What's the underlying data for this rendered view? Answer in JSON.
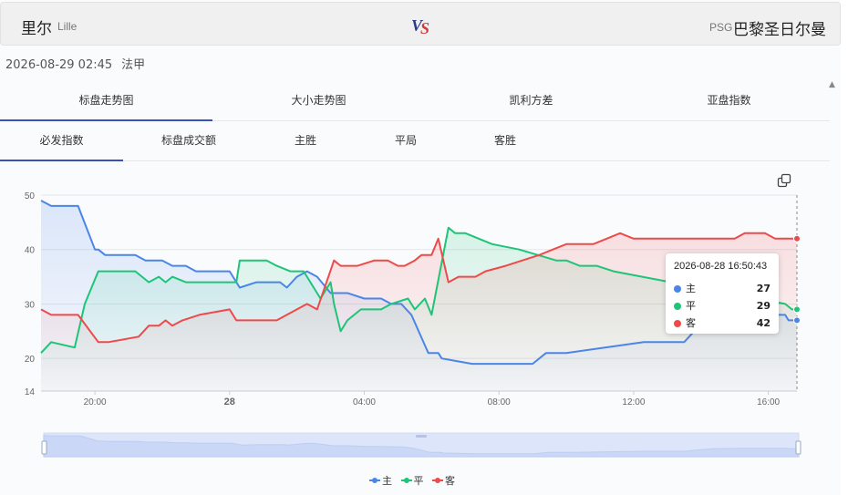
{
  "match": {
    "home_name": "里尔",
    "home_en": "Lille",
    "vs_v": "V",
    "vs_s": "S",
    "away_abbr": "PSG",
    "away_name": "巴黎圣日尔曼",
    "datetime": "2026-08-29 02:45",
    "league": "法甲"
  },
  "tabs_primary": [
    {
      "label": "标盘走势图",
      "active": true
    },
    {
      "label": "大小走势图",
      "active": false
    },
    {
      "label": "凯利方差",
      "active": false
    },
    {
      "label": "亚盘指数",
      "active": false
    }
  ],
  "tabs_secondary": [
    {
      "label": "必发指数",
      "active": true
    },
    {
      "label": "标盘成交额",
      "active": false
    },
    {
      "label": "主胜",
      "active": false
    },
    {
      "label": "平局",
      "active": false
    },
    {
      "label": "客胜",
      "active": false
    }
  ],
  "tooltip": {
    "time": "2026-08-28 16:50:43",
    "rows": [
      {
        "name": "主",
        "value": "27"
      },
      {
        "name": "平",
        "value": "29"
      },
      {
        "name": "客",
        "value": "42"
      }
    ]
  },
  "colors": {
    "home": "#4a86e8",
    "draw": "#1ec477",
    "away": "#ee4a4a",
    "tab_accent": "#3a51b8"
  },
  "chart_data": {
    "type": "area",
    "x_unit": "hours from 2026-08-27 18:00",
    "x_ticks": [
      {
        "x": 2,
        "label": "20:00",
        "bold": false
      },
      {
        "x": 6,
        "label": "28",
        "bold": true
      },
      {
        "x": 10,
        "label": "04:00",
        "bold": false
      },
      {
        "x": 14,
        "label": "08:00",
        "bold": false
      },
      {
        "x": 18,
        "label": "12:00",
        "bold": false
      },
      {
        "x": 22,
        "label": "16:00",
        "bold": false
      }
    ],
    "xlim": [
      0.4,
      22.85
    ],
    "ylim": [
      14,
      50
    ],
    "y_ticks": [
      14,
      20,
      30,
      40,
      50
    ],
    "legend": "bottom",
    "grid": true,
    "series": [
      {
        "name": "主",
        "color": "#4a86e8",
        "points": [
          [
            0.4,
            49
          ],
          [
            0.7,
            48
          ],
          [
            1.4,
            48
          ],
          [
            1.5,
            48
          ],
          [
            2.0,
            40
          ],
          [
            2.1,
            40
          ],
          [
            2.3,
            39
          ],
          [
            3.2,
            39
          ],
          [
            3.5,
            38
          ],
          [
            4.0,
            38
          ],
          [
            4.3,
            37
          ],
          [
            4.7,
            37
          ],
          [
            5.0,
            36
          ],
          [
            6.0,
            36
          ],
          [
            6.3,
            33
          ],
          [
            6.8,
            34
          ],
          [
            7.5,
            34
          ],
          [
            7.7,
            33
          ],
          [
            8.0,
            35
          ],
          [
            8.3,
            36
          ],
          [
            8.6,
            35
          ],
          [
            9.0,
            32
          ],
          [
            9.5,
            32
          ],
          [
            10.0,
            31
          ],
          [
            10.5,
            31
          ],
          [
            10.8,
            30
          ],
          [
            11.1,
            30
          ],
          [
            11.4,
            28
          ],
          [
            11.9,
            21
          ],
          [
            12.2,
            21
          ],
          [
            12.3,
            20
          ],
          [
            13.2,
            19
          ],
          [
            14.0,
            19
          ],
          [
            15.0,
            19
          ],
          [
            15.4,
            21
          ],
          [
            16.0,
            21
          ],
          [
            18.3,
            23
          ],
          [
            19.0,
            23
          ],
          [
            19.5,
            23
          ],
          [
            19.8,
            25
          ],
          [
            20.3,
            27
          ],
          [
            21.2,
            28
          ],
          [
            21.9,
            28
          ],
          [
            22.5,
            28
          ],
          [
            22.6,
            27
          ],
          [
            22.85,
            27
          ]
        ]
      },
      {
        "name": "平",
        "color": "#1ec477",
        "points": [
          [
            0.4,
            21
          ],
          [
            0.7,
            23
          ],
          [
            1.4,
            22
          ],
          [
            1.7,
            30
          ],
          [
            2.1,
            36
          ],
          [
            3.2,
            36
          ],
          [
            3.6,
            34
          ],
          [
            3.9,
            35
          ],
          [
            4.1,
            34
          ],
          [
            4.3,
            35
          ],
          [
            4.7,
            34
          ],
          [
            5.2,
            34
          ],
          [
            6.2,
            34
          ],
          [
            6.3,
            38
          ],
          [
            7.1,
            38
          ],
          [
            7.4,
            37
          ],
          [
            7.8,
            36
          ],
          [
            8.2,
            36
          ],
          [
            8.7,
            31
          ],
          [
            9.0,
            34
          ],
          [
            9.1,
            30
          ],
          [
            9.3,
            25
          ],
          [
            9.5,
            27
          ],
          [
            9.9,
            29
          ],
          [
            10.5,
            29
          ],
          [
            10.8,
            30
          ],
          [
            11.3,
            31
          ],
          [
            11.5,
            29
          ],
          [
            11.8,
            31
          ],
          [
            12.0,
            28
          ],
          [
            12.5,
            44
          ],
          [
            12.7,
            43
          ],
          [
            13.0,
            43
          ],
          [
            13.8,
            41
          ],
          [
            14.6,
            40
          ],
          [
            15.7,
            38
          ],
          [
            16.0,
            38
          ],
          [
            16.4,
            37
          ],
          [
            16.9,
            37
          ],
          [
            17.4,
            36
          ],
          [
            22.5,
            30
          ],
          [
            22.7,
            29
          ],
          [
            22.85,
            29
          ]
        ]
      },
      {
        "name": "客",
        "color": "#ee4a4a",
        "points": [
          [
            0.4,
            29
          ],
          [
            0.7,
            28
          ],
          [
            1.5,
            28
          ],
          [
            2.1,
            23
          ],
          [
            2.4,
            23
          ],
          [
            3.3,
            24
          ],
          [
            3.6,
            26
          ],
          [
            3.9,
            26
          ],
          [
            4.1,
            27
          ],
          [
            4.3,
            26
          ],
          [
            4.6,
            27
          ],
          [
            5.1,
            28
          ],
          [
            6.0,
            29
          ],
          [
            6.2,
            27
          ],
          [
            7.4,
            27
          ],
          [
            8.0,
            29
          ],
          [
            8.3,
            30
          ],
          [
            8.6,
            29
          ],
          [
            9.1,
            38
          ],
          [
            9.3,
            37
          ],
          [
            9.8,
            37
          ],
          [
            10.3,
            38
          ],
          [
            10.7,
            38
          ],
          [
            11.0,
            37
          ],
          [
            11.2,
            37
          ],
          [
            11.5,
            38
          ],
          [
            11.7,
            39
          ],
          [
            12.0,
            39
          ],
          [
            12.2,
            42
          ],
          [
            12.5,
            34
          ],
          [
            12.8,
            35
          ],
          [
            13.3,
            35
          ],
          [
            13.6,
            36
          ],
          [
            14.2,
            37
          ],
          [
            15.2,
            39
          ],
          [
            15.6,
            40
          ],
          [
            16.0,
            41
          ],
          [
            16.8,
            41
          ],
          [
            17.2,
            42
          ],
          [
            17.6,
            43
          ],
          [
            18.0,
            42
          ],
          [
            21.0,
            42
          ],
          [
            21.3,
            43
          ],
          [
            21.9,
            43
          ],
          [
            22.2,
            42
          ],
          [
            22.5,
            42
          ],
          [
            22.7,
            42
          ],
          [
            22.85,
            42
          ]
        ]
      }
    ]
  }
}
